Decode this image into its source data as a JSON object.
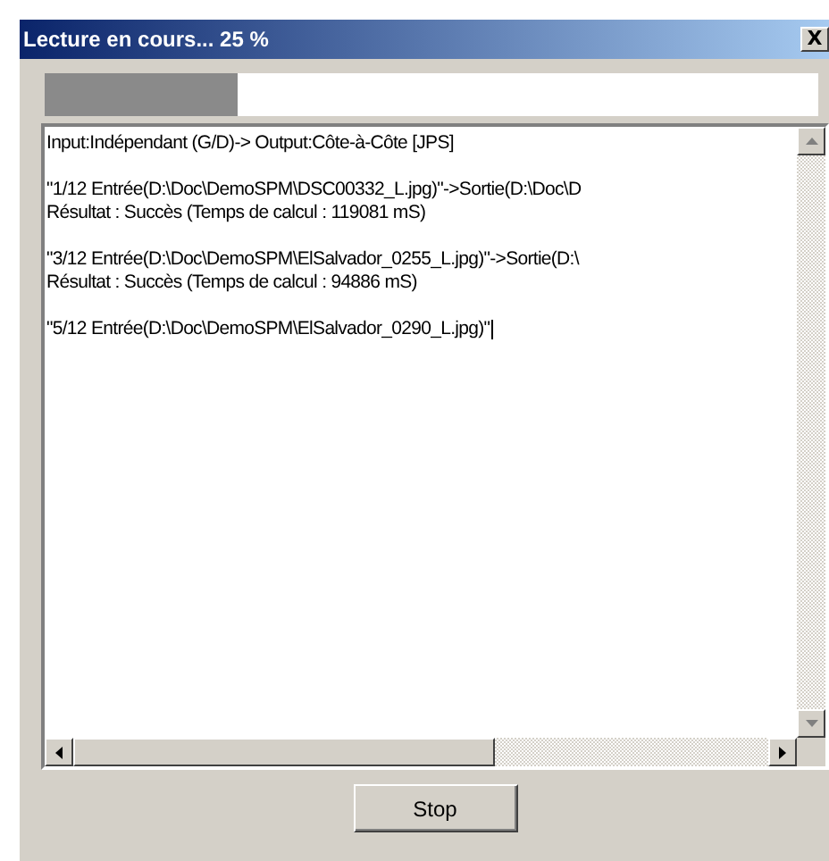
{
  "window": {
    "title": "Lecture en cours... 25 %",
    "close": "X"
  },
  "progress": {
    "level": 0.25
  },
  "log": {
    "blocks": [
      {
        "lines": [
          {
            "text": "Input:Indépendant (G/D)-> Output:Côte-à-Côte [JPS]"
          }
        ]
      },
      {
        "lines": [
          {
            "text": "\"1/12 Entrée(D:\\Doc\\DemoSPM\\DSC00332_L.jpg)\"->Sortie(D:\\Doc\\D"
          },
          {
            "text": "Résultat : Succès (Temps de calcul : 119081 mS)"
          }
        ]
      },
      {
        "lines": [
          {
            "text": "\"3/12 Entrée(D:\\Doc\\DemoSPM\\ElSalvador_0255_L.jpg)\"->Sortie(D:\\"
          },
          {
            "text": "Résultat : Succès (Temps de calcul : 94886 mS)"
          }
        ]
      },
      {
        "lines": [
          {
            "text": "\"5/12 Entrée(D:\\Doc\\DemoSPM\\ElSalvador_0290_L.jpg)\"",
            "caret": true
          }
        ]
      }
    ]
  },
  "buttons": [
    {
      "label": "Stop"
    }
  ]
}
